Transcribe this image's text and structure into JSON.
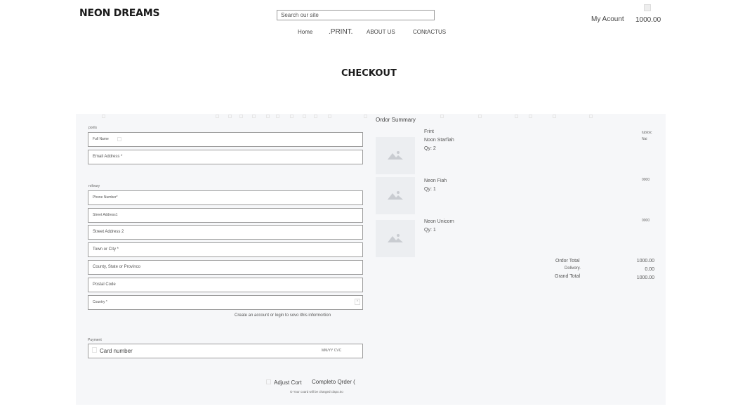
{
  "header": {
    "logo": "NEON DREAMS",
    "search_placeholder": "Search our site",
    "nav": [
      "Home",
      ".PRINT.",
      "ABOUT US",
      "CONtACTUS"
    ],
    "account_label": "My Acount",
    "cart_total": "1000.00"
  },
  "page_title": "CHECKOUT",
  "form": {
    "contact_label": "porils",
    "full_name": "Full Name",
    "email": "Email Address *",
    "delivery_label": "rolivary",
    "phone": "Phone Number*",
    "street1": "Street Address1",
    "street2": "Street Address 2",
    "town": "Town or City *",
    "county": "County, State or Provinco",
    "postal": "Postal Code",
    "country": "Country *",
    "account_help": "Create an account or login to sovo ithis informortion",
    "payment_label": "Puyment",
    "card_number": "Card number",
    "card_meta": "MM/YY CVC",
    "adjust_cart": "Adjust Cort",
    "complete_order": "Completo Qrder (",
    "charge_note": "O Your coard will be charged clapo.0o"
  },
  "summary": {
    "title": "Ordor Summary",
    "items": [
      {
        "line1": "Frint",
        "line2": "Noon Starfiah",
        "qty": "Qy: 2",
        "price1": "tubloic",
        "price2": "Nai"
      },
      {
        "line1": "Neon Fiah",
        "line2": "Qy: 1",
        "qty": "",
        "price1": "0000",
        "price2": ""
      },
      {
        "line1": "Neon Unicorn",
        "line2": "Qy: 1",
        "qty": "",
        "price1": "0000",
        "price2": ""
      }
    ],
    "order_total_label": "Ordor Total",
    "order_total_value": "1000.00",
    "delivery_label": "Dolivory.",
    "delivery_value": "0.00",
    "grand_total_label": "Grand Total",
    "grand_total_value": "1000.00"
  },
  "icons": {
    "thumbnail": "image-placeholder-icon",
    "country_clear": "close-icon",
    "card": "credit-card-icon",
    "cart": "cart-icon"
  }
}
